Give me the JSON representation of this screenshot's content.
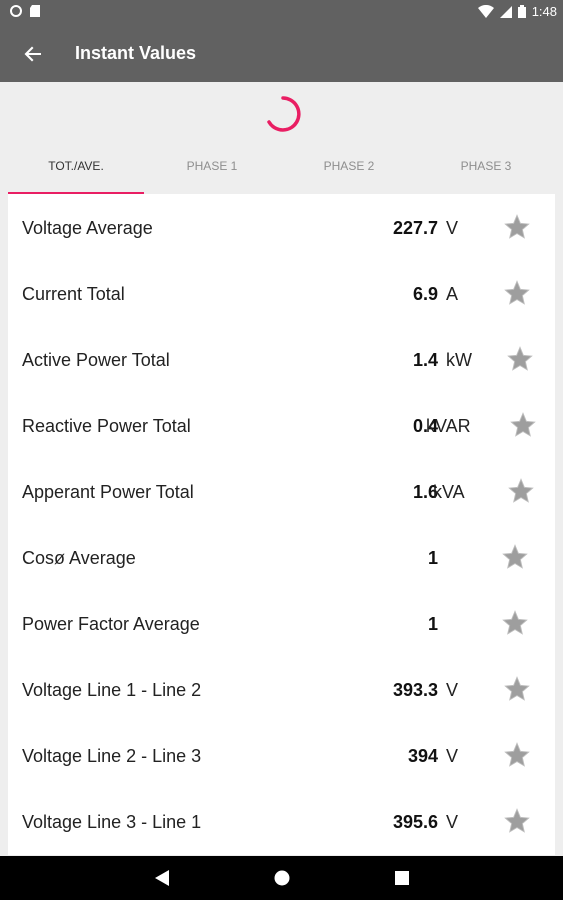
{
  "status_bar": {
    "time": "1:48"
  },
  "app_bar": {
    "title": "Instant Values"
  },
  "tabs": [
    {
      "label": "TOT./AVE.",
      "active": true
    },
    {
      "label": "PHASE 1",
      "active": false
    },
    {
      "label": "PHASE 2",
      "active": false
    },
    {
      "label": "PHASE 3",
      "active": false
    }
  ],
  "rows": [
    {
      "label": "Voltage Average",
      "value": "227.7",
      "unit": "V"
    },
    {
      "label": "Current Total",
      "value": "6.9",
      "unit": "A"
    },
    {
      "label": "Active Power Total",
      "value": "1.4",
      "unit": "kW"
    },
    {
      "label": "Reactive Power Total",
      "value": "0.4",
      "unit": "kVAR"
    },
    {
      "label": "Apperant Power Total",
      "value": "1.6",
      "unit": "kVA"
    },
    {
      "label": "Cosø Average",
      "value": "1",
      "unit": ""
    },
    {
      "label": "Power Factor Average",
      "value": "1",
      "unit": ""
    },
    {
      "label": "Voltage Line 1 - Line 2",
      "value": "393.3",
      "unit": "V"
    },
    {
      "label": "Voltage Line 2 - Line 3",
      "value": "394",
      "unit": "V"
    },
    {
      "label": "Voltage Line 3 - Line 1",
      "value": "395.6",
      "unit": "V"
    }
  ],
  "colors": {
    "app_bar": "#616161",
    "accent": "#e91e63",
    "star": "#9e9e9e"
  },
  "icons": [
    "back-arrow-icon",
    "loading-spinner-icon",
    "star-icon",
    "nav-back-icon",
    "nav-home-icon",
    "nav-recents-icon"
  ]
}
